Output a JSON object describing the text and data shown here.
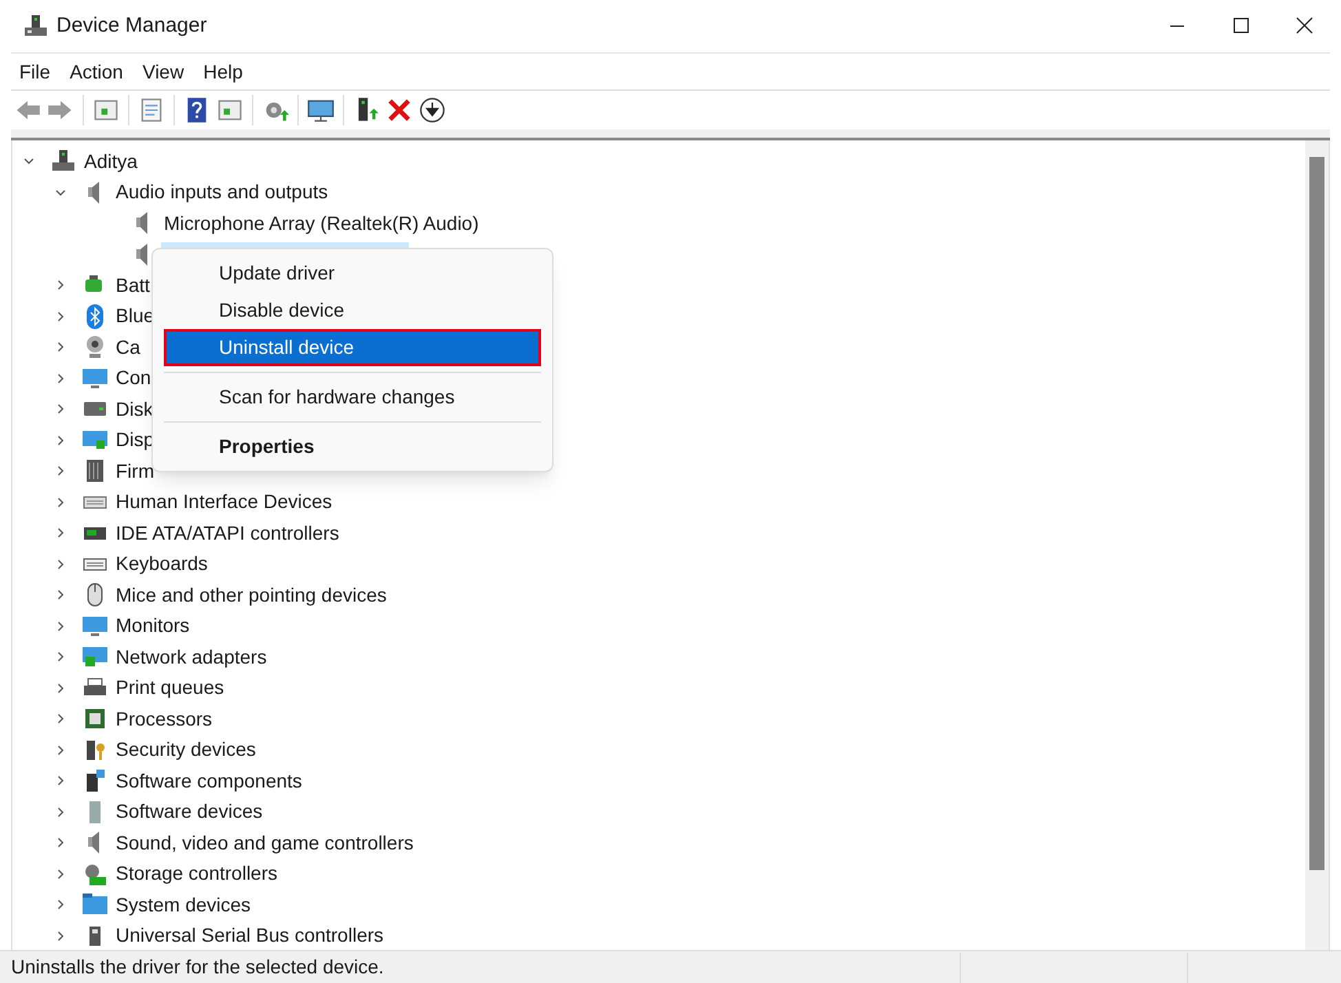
{
  "window": {
    "title": "Device Manager"
  },
  "menu": [
    "File",
    "Action",
    "View",
    "Help"
  ],
  "tree": [
    {
      "label": "Aditya",
      "expanded": true,
      "children": [
        {
          "label": "Audio inputs and outputs",
          "expanded": true,
          "children": [
            {
              "label": "Microphone Array (Realtek(R) Audio)",
              "selected": false
            },
            {
              "selected": true
            }
          ]
        },
        {
          "label": "Batt",
          "expanded": false
        },
        {
          "label": "Blue",
          "expanded": false
        },
        {
          "label": "Ca",
          "expanded": false
        },
        {
          "label": "Con",
          "expanded": false
        },
        {
          "label": "Disk",
          "expanded": false
        },
        {
          "label": "Disp",
          "expanded": false
        },
        {
          "label": "Firm",
          "expanded": false
        },
        {
          "label": "Human Interface Devices",
          "expanded": false
        },
        {
          "label": "IDE ATA/ATAPI controllers",
          "expanded": false
        },
        {
          "label": "Keyboards",
          "expanded": false
        },
        {
          "label": "Mice and other pointing devices",
          "expanded": false
        },
        {
          "label": "Monitors",
          "expanded": false
        },
        {
          "label": "Network adapters",
          "expanded": false
        },
        {
          "label": "Print queues",
          "expanded": false
        },
        {
          "label": "Processors",
          "expanded": false
        },
        {
          "label": "Security devices",
          "expanded": false
        },
        {
          "label": "Software components",
          "expanded": false
        },
        {
          "label": "Software devices",
          "expanded": false
        },
        {
          "label": "Sound, video and game controllers",
          "expanded": false
        },
        {
          "label": "Storage controllers",
          "expanded": false
        },
        {
          "label": "System devices",
          "expanded": false
        },
        {
          "label": "Universal Serial Bus controllers",
          "expanded": false
        }
      ]
    }
  ],
  "context_menu": [
    {
      "kind": "item",
      "label": "Update driver",
      "selected": false,
      "bold": false
    },
    {
      "kind": "item",
      "label": "Disable device",
      "selected": false,
      "bold": false
    },
    {
      "kind": "item",
      "label": "Uninstall device",
      "selected": true,
      "bold": false
    },
    {
      "kind": "separator"
    },
    {
      "kind": "item",
      "label": "Scan for hardware changes",
      "selected": false,
      "bold": false
    },
    {
      "kind": "separator"
    },
    {
      "kind": "item",
      "label": "Properties",
      "selected": false,
      "bold": true
    }
  ],
  "status_bar": "Uninstalls the driver for the selected device."
}
